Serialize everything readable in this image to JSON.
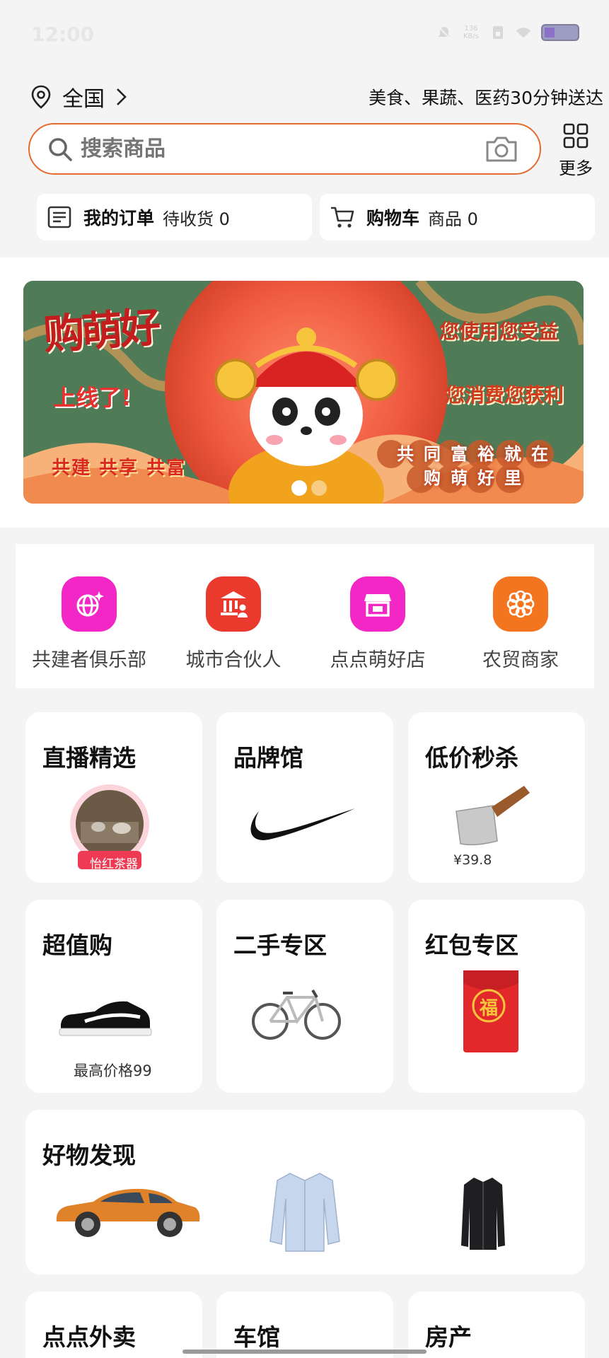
{
  "status_bar": {
    "time": "12:00",
    "net_speed_value": "136",
    "net_speed_unit": "KB/s"
  },
  "location": {
    "name": "全国",
    "slogan": "美食、果蔬、医药30分钟送达"
  },
  "search": {
    "placeholder": "搜索商品"
  },
  "more": {
    "label": "更多"
  },
  "quick_cards": {
    "orders_title": "我的订单",
    "orders_status": "待收货 0",
    "cart_title": "购物车",
    "cart_status": "商品 0"
  },
  "banner": {
    "title": "购萌好",
    "online": "上线了!",
    "slogan": "共建 共享 共富",
    "right_line1": "您使用您受益",
    "right_line2": "您消费您获利",
    "right_line3": "共同富裕就在购萌好里",
    "slide_count": 2,
    "active_slide": 1
  },
  "services": [
    {
      "label": "共建者俱乐部",
      "icon": "globe-sparkle-icon",
      "color": "#f227c6"
    },
    {
      "label": "城市合伙人",
      "icon": "bank-person-icon",
      "color": "#ea3a2e"
    },
    {
      "label": "点点萌好店",
      "icon": "shop-icon",
      "color": "#f227c6"
    },
    {
      "label": "农贸商家",
      "icon": "flower-icon",
      "color": "#f47520"
    }
  ],
  "tiles": {
    "live": {
      "title": "直播精选",
      "badge": "怡红茶器"
    },
    "brand": {
      "title": "品牌馆"
    },
    "flash": {
      "title": "低价秒杀",
      "price": "¥39.8"
    },
    "value": {
      "title": "超值购",
      "caption": "最高价格99"
    },
    "secondhand": {
      "title": "二手专区"
    },
    "redpacket": {
      "title": "红包专区",
      "symbol": "福"
    },
    "discover": {
      "title": "好物发现"
    },
    "takeaway": {
      "title": "点点外卖"
    },
    "cars": {
      "title": "车馆"
    },
    "realestate": {
      "title": "房产"
    }
  },
  "colors": {
    "accent": "#e46a2f",
    "page_bg": "#f4f4f5"
  }
}
